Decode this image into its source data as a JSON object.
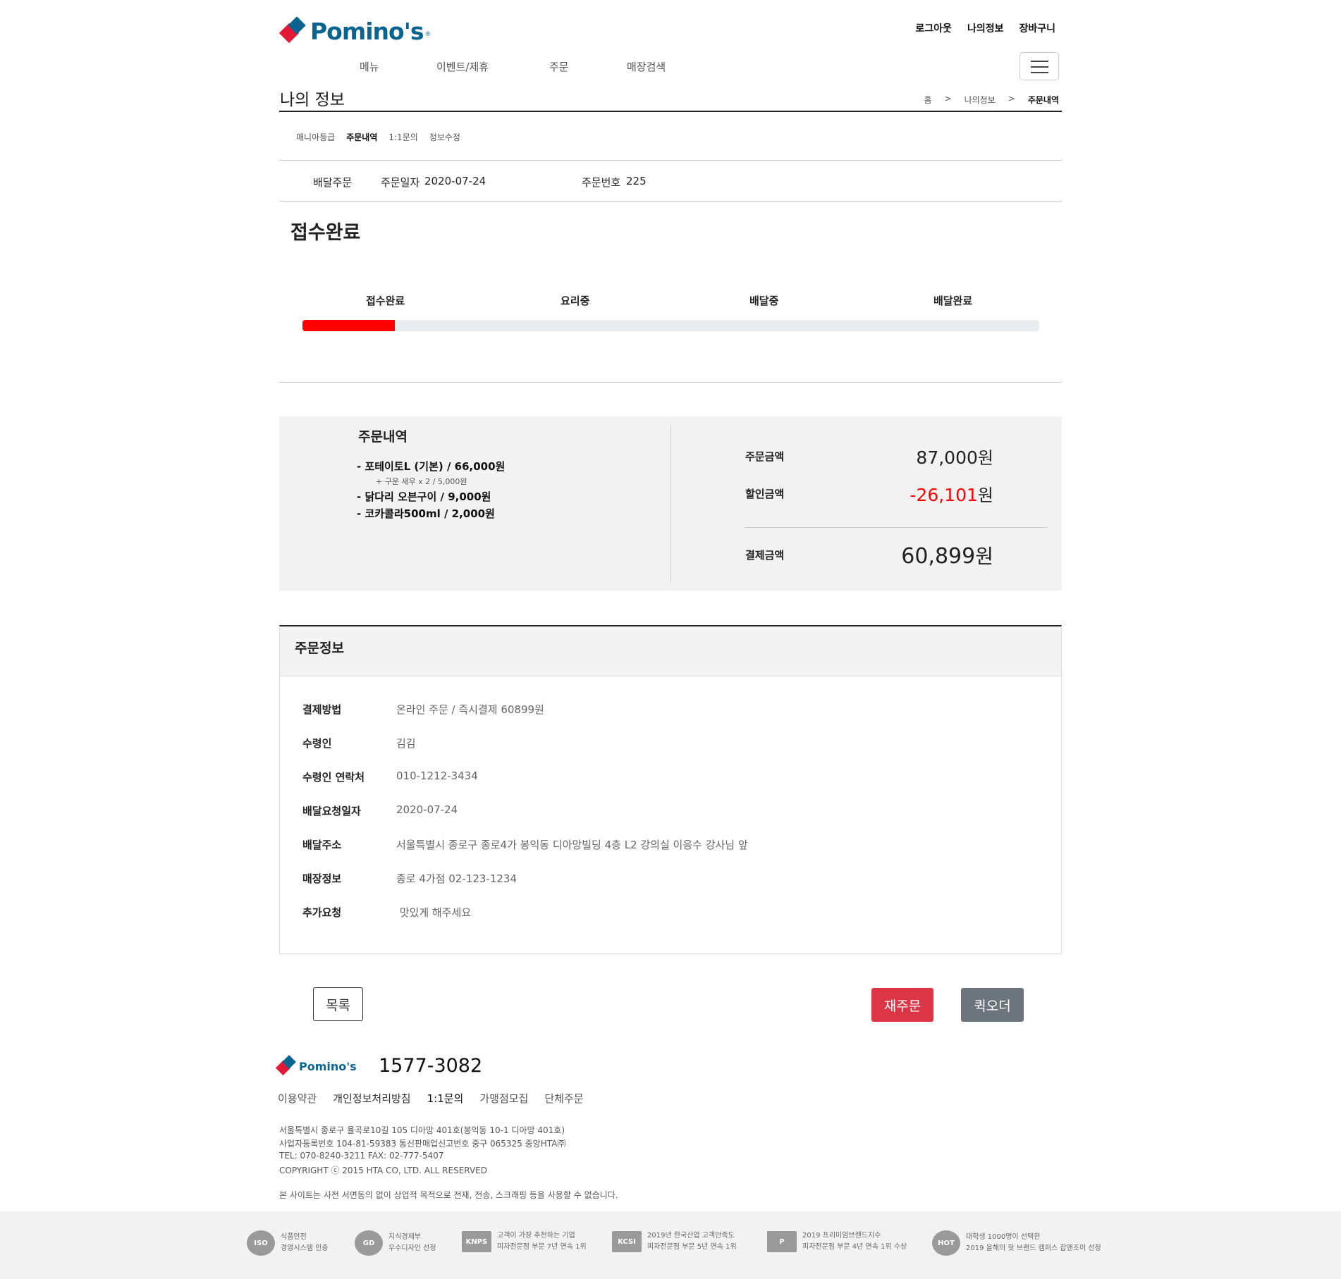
{
  "header": {
    "brand": "Pomino's",
    "reg": "®",
    "top_links": [
      "로그아웃",
      "나의정보",
      "장바구니"
    ],
    "nav": [
      "메뉴",
      "이벤트/제휴",
      "주문",
      "매장검색"
    ]
  },
  "page": {
    "title": "나의 정보",
    "breadcrumb": [
      "홈",
      ">",
      "나의정보",
      ">",
      "주문내역"
    ],
    "sub_tabs": [
      "매니아등급",
      "주문내역",
      "1:1문의",
      "정보수정"
    ]
  },
  "order": {
    "type": "배달주문",
    "date_label": "주문일자",
    "date": "2020-07-24",
    "number_label": "주문번호",
    "number": "225"
  },
  "status": {
    "title": "접수완료",
    "steps": [
      "접수완료",
      "요리중",
      "배달중",
      "배달완료"
    ],
    "progress": 0.125,
    "progress_color": "#ff0000"
  },
  "summary": {
    "title": "주문내역",
    "items": [
      "- 포테이토L (기본) / 66,000원",
      "- 닭다리 오븐구이 / 9,000원",
      "- 코카콜라500ml / 2,000원"
    ],
    "item_option": "+ 구운 새우 x 2 / 5,000원",
    "order_amount_label": "주문금액",
    "order_amount": "87,000",
    "discount_label": "할인금액",
    "discount": "-26,101",
    "discount_color": "#ff0000",
    "payment_label": "결제금액",
    "payment": "60,899",
    "won": "원"
  },
  "info": {
    "title": "주문정보",
    "rows": [
      {
        "label": "결제방법",
        "value": "온라인 주문 / 즉시결제 60899원"
      },
      {
        "label": "수령인",
        "value": "김김"
      },
      {
        "label": "수령인 연락처",
        "value": "010-1212-3434"
      },
      {
        "label": "배달요청일자",
        "value": "2020-07-24"
      },
      {
        "label": "배달주소",
        "value": "서울특별시 종로구 종로4가 봉익동 디아망빌딩 4층 L2 강의실 이응수 강사님 앞"
      },
      {
        "label": "매장정보",
        "value": "종로 4가점 02-123-1234"
      },
      {
        "label": "추가요청",
        "value": " 맛있게 해주세요"
      }
    ]
  },
  "buttons": {
    "list": "목록",
    "reorder": "재주문",
    "quick": "퀵오더"
  },
  "footer": {
    "brand": "Pomino's",
    "phone": "1577-3082",
    "links": [
      "이용약관",
      "개인정보처리방침",
      "1:1문의",
      "가맹점모집",
      "단체주문"
    ],
    "address": [
      "서울특별시 종로구 율곡로10길 105 디아망 401호(봉익동 10-1 디아망 401호)",
      "사업자등록번호 104-81-59383 통신판매업신고번호 중구 065325 중앙HTA㈜",
      "TEL: 070-8240-3211 FAX: 02-777-5407",
      "COPYRIGHT ⓒ 2015 HTA CO, LTD. ALL RESERVED"
    ],
    "notice": "본 사이트는 사전 서면동의 없이 상업적 목적으로 전재, 전송, 스크래핑 등을 사용할 수 없습니다.",
    "certs": [
      {
        "icon": "ISO",
        "l1": "식품안전",
        "l2": "경영시스템 인증"
      },
      {
        "icon": "GD",
        "l1": "지식경제부",
        "l2": "우수디자인 선정"
      },
      {
        "icon": "KNPS",
        "l1": "고객이 가장 추천하는 기업",
        "l2": "피자전문점 부문 7년 연속 1위"
      },
      {
        "icon": "KCSI",
        "l1": "2019년 한국산업 고객만족도",
        "l2": "피자전문점 부문 5년 연속 1위"
      },
      {
        "icon": "P",
        "l1": "2019 프리미엄브랜드지수",
        "l2": "피자전문점 부문 4년 연속 1위 수상"
      },
      {
        "icon": "HOT",
        "l1": "대학생 1000명이 선택한",
        "l2": "2019 올해의 핫 브랜드 캠퍼스 잡앤조이 선정"
      }
    ]
  }
}
